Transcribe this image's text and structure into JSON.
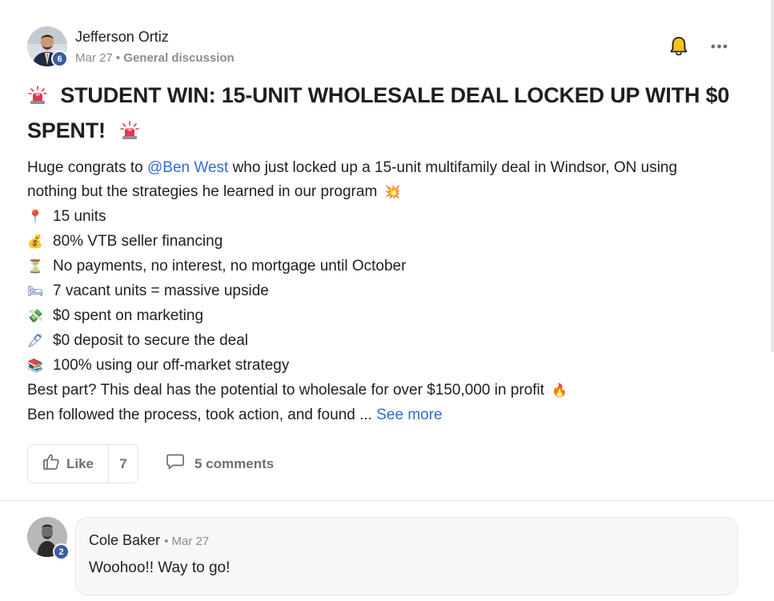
{
  "post": {
    "author": {
      "name": "Jefferson Ortiz",
      "level": "6"
    },
    "date": "Mar 27",
    "separator": "•",
    "category": "General discussion",
    "title": "STUDENT WIN: 15-UNIT WHOLESALE DEAL LOCKED UP WITH $0 SPENT!",
    "intro_before": "Huge congrats to ",
    "mention": "@Ben West",
    "intro_after": " who just locked up a 15-unit multifamily deal in Windsor, ON using",
    "intro_line2": "nothing but the strategies he learned in our program",
    "bullets": [
      {
        "icon": "📍",
        "text": "15 units"
      },
      {
        "icon": "💰",
        "text": "80% VTB seller financing"
      },
      {
        "icon": "⏳",
        "text": "No payments, no interest, no mortgage until October"
      },
      {
        "icon": "🛏",
        "text": "7 vacant units = massive upside"
      },
      {
        "icon": "💸",
        "text": "$0 spent on marketing"
      },
      {
        "icon": "🖊",
        "text": "$0 deposit to secure the deal"
      },
      {
        "icon": "📚",
        "text": "100% using our off-market strategy"
      }
    ],
    "best_part": "Best part? This deal has the potential to wholesale for over $150,000 in profit",
    "last_line": "Ben followed the process, took action, and found ...",
    "see_more": "See more",
    "like_label": "Like",
    "like_count": "7",
    "comments_label": "5 comments",
    "icons": {
      "siren": "siren-emoji",
      "intro_tail": "💥",
      "best_part_tail": "🔥",
      "bell": "bell-icon",
      "more": "more-dots-icon",
      "like": "thumbs-up-icon",
      "comment": "comment-bubble-icon"
    }
  },
  "comment": {
    "author": "Cole Baker",
    "level": "2",
    "date": "Mar 27",
    "separator": "•",
    "text": "Woohoo!! Way to go!"
  },
  "colors": {
    "mention": "#2f6ad6",
    "badge": "#3d5ca3",
    "muted": "#8b8b8b",
    "bell_fill": "#f5c518"
  }
}
